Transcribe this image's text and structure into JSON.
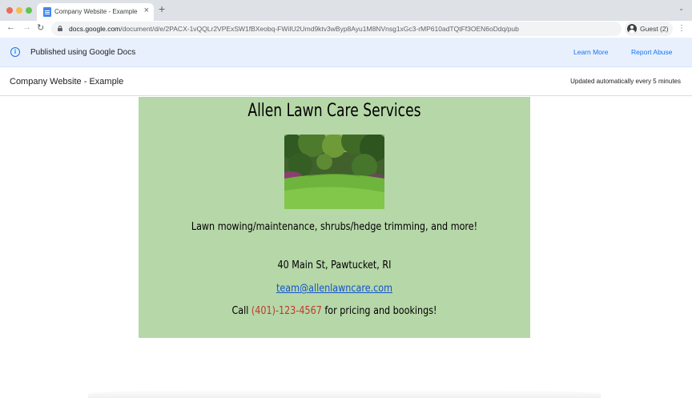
{
  "browser": {
    "tab_title": "Company Website - Example",
    "url_host": "docs.google.com",
    "url_path": "/document/d/e/2PACX-1vQQLr2VPExSW1fBXeobq-FWiIU2Umd9ktv3wByp8Ayu1M8NVnsg1xGc3-rMP610adTQtFf3OEN6oDdq/pub",
    "profile_label": "Guest (2)"
  },
  "banner": {
    "text": "Published using Google Docs",
    "learn_more": "Learn More",
    "report_abuse": "Report Abuse"
  },
  "doc_bar": {
    "title": "Company Website - Example",
    "updated": "Updated automatically every 5 minutes"
  },
  "document": {
    "heading": "Allen Lawn Care Services",
    "tagline": "Lawn mowing/maintenance, shrubs/hedge trimming, and more!",
    "address": "40 Main St, Pawtucket, RI",
    "email": "team@allenlawncare.com",
    "call_prefix": "Call ",
    "phone": "(401)-123-4567",
    "call_suffix": " for pricing and bookings!"
  },
  "colors": {
    "page_background": "#b6d7a8",
    "link": "#1155cc",
    "phone": "#c0392b",
    "banner": "#e8f0fe"
  },
  "icons": [
    "docs-icon",
    "close-icon",
    "new-tab-icon",
    "back-icon",
    "forward-icon",
    "reload-icon",
    "lock-icon",
    "profile-icon",
    "kebab-menu-icon",
    "info-icon",
    "garden-photo"
  ]
}
